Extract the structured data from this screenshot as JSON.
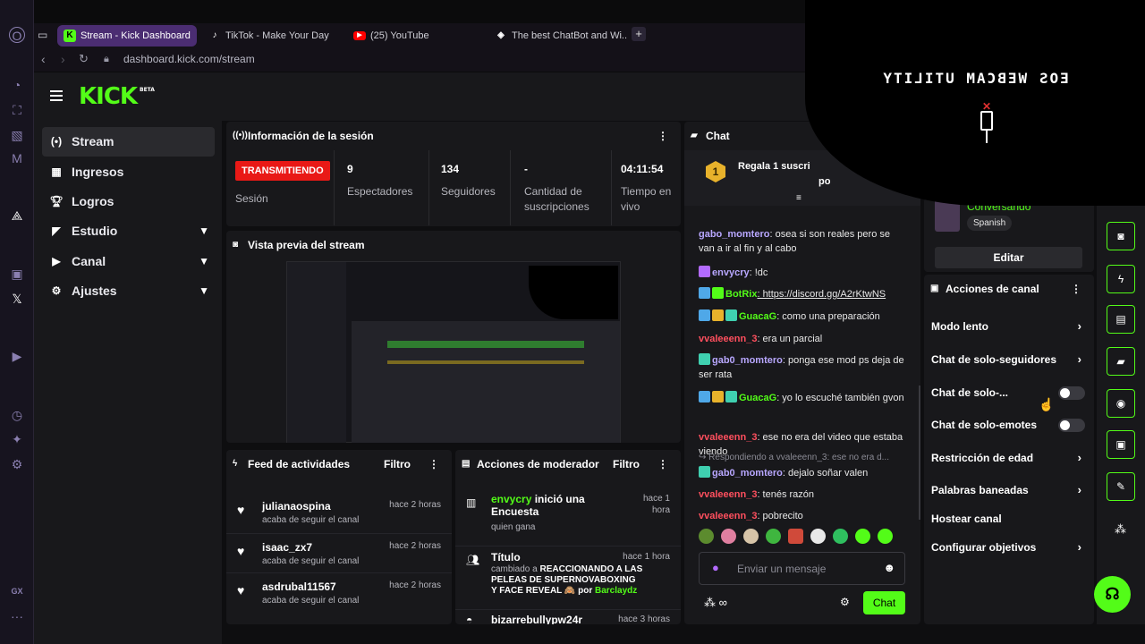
{
  "browser": {
    "tabs": [
      {
        "title": "Stream - Kick Dashboard",
        "active": true
      },
      {
        "title": "TikTok - Make Your Day"
      },
      {
        "title": "(25) YouTube"
      },
      {
        "title": "The best ChatBot and Wi..."
      }
    ],
    "url": "dashboard.kick.com/stream",
    "gx_label": "GX"
  },
  "kick": {
    "logo": "KICK",
    "logo_beta": "BETA",
    "sidebar": {
      "items": [
        {
          "label": "Stream",
          "icon": "broadcast-icon",
          "active": true
        },
        {
          "label": "Ingresos",
          "icon": "chart-icon"
        },
        {
          "label": "Logros",
          "icon": "trophy-icon"
        },
        {
          "label": "Estudio",
          "icon": "studio-icon",
          "expandable": true
        },
        {
          "label": "Canal",
          "icon": "channel-icon",
          "expandable": true
        },
        {
          "label": "Ajustes",
          "icon": "gear-icon",
          "expandable": true
        }
      ]
    },
    "session": {
      "title": "Información de la sesión",
      "live_badge": "TRANSMITIENDO",
      "session_label": "Sesión",
      "stats": [
        {
          "value": "9",
          "label": "Espectadores"
        },
        {
          "value": "134",
          "label": "Seguidores"
        },
        {
          "value": "-",
          "label": "Cantidad de suscripciones"
        },
        {
          "value": "04:11:54",
          "label": "Tiempo en vivo"
        }
      ]
    },
    "preview": {
      "title": "Vista previa del stream"
    },
    "activity": {
      "title": "Feed de actividades",
      "filter": "Filtro",
      "items": [
        {
          "name": "julianaospina",
          "action": "acaba de seguir el canal",
          "time": "hace 2 horas"
        },
        {
          "name": "isaac_zx7",
          "action": "acaba de seguir el canal",
          "time": "hace 2 horas"
        },
        {
          "name": "asdrubal11567",
          "action": "acaba de seguir el canal",
          "time": "hace 2 horas"
        }
      ]
    },
    "mod_actions": {
      "title": "Acciones de moderador",
      "filter": "Filtro",
      "items": [
        {
          "user": "envycry",
          "text": "inició una Encuesta",
          "sub": "quien gana",
          "time": "hace 1 hora"
        },
        {
          "user": "",
          "text": "Título",
          "sub_prefix": "cambiado a",
          "sub": "REACCIONANDO A LAS PELEAS DE SUPERNOVABOXING Y FACE REVEAL 🙈 por",
          "sub_user": "Barclaydz",
          "time": "hace 1 hora"
        },
        {
          "user": "bizarrebullypw24r",
          "text": "",
          "sub": "",
          "time": "hace 3 horas"
        }
      ]
    },
    "chat": {
      "title": "Chat",
      "pinned": {
        "rank": "1",
        "text": "Regala 1 suscri",
        "text2": "po"
      },
      "messages": [
        {
          "user": "gabo_momtero",
          "color": "#b8a7ff",
          "text": "osea si son reales pero se van a ir al fin y al cabo"
        },
        {
          "user": "envycry",
          "color": "#b8a7ff",
          "text": "!dc"
        },
        {
          "user": "BotRix",
          "color": "#53fc18",
          "text": "https://discord.gg/A2rKtwNS"
        },
        {
          "user": "GuacaG",
          "color": "#53fc18",
          "text": "como una preparación"
        },
        {
          "user": "vvaleeenn_3",
          "color": "#ff4f5e",
          "text": "era un parcial"
        },
        {
          "user": "gab0_momtero",
          "color": "#b8a7ff",
          "text": "ponga ese mod ps deja de ser rata"
        },
        {
          "user": "GuacaG",
          "color": "#53fc18",
          "text": "yo lo escuché también gvon"
        },
        {
          "user": "vvaleeenn_3",
          "color": "#ff4f5e",
          "text": "ese no era del video que estaba viendo"
        },
        {
          "user": "gab0_momtero",
          "color": "#b8a7ff",
          "text": "dejalo soñar valen",
          "reply": "Respondiendo a vvaleeenn_3: ese no era d..."
        },
        {
          "user": "vvaleeenn_3",
          "color": "#ff4f5e",
          "text": "tenés razón"
        },
        {
          "user": "vvaleeenn_3",
          "color": "#ff4f5e",
          "text": "pobrecito"
        }
      ],
      "placeholder": "Enviar un mensaje",
      "send": "Chat"
    },
    "stream_info": {
      "status": "Conversando",
      "language": "Spanish",
      "edit": "Editar"
    },
    "channel_actions": {
      "title": "Acciones de canal",
      "items": [
        {
          "label": "Modo lento",
          "type": "arrow"
        },
        {
          "label": "Chat de solo-seguidores",
          "type": "arrow"
        },
        {
          "label": "Chat de solo-...",
          "type": "toggle"
        },
        {
          "label": "Chat de solo-emotes",
          "type": "toggle"
        },
        {
          "label": "Restricción de edad",
          "type": "arrow"
        },
        {
          "label": "Palabras baneadas",
          "type": "arrow"
        },
        {
          "label": "Hostear canal",
          "type": "none"
        },
        {
          "label": "Configurar objetivos",
          "type": "arrow"
        }
      ]
    }
  },
  "webcam_overlay": {
    "text": "EOS WEBCAM UTILITY"
  },
  "colors": {
    "brand": "#53fc18",
    "live": "#e91916",
    "tab_active": "#4b2d72"
  }
}
